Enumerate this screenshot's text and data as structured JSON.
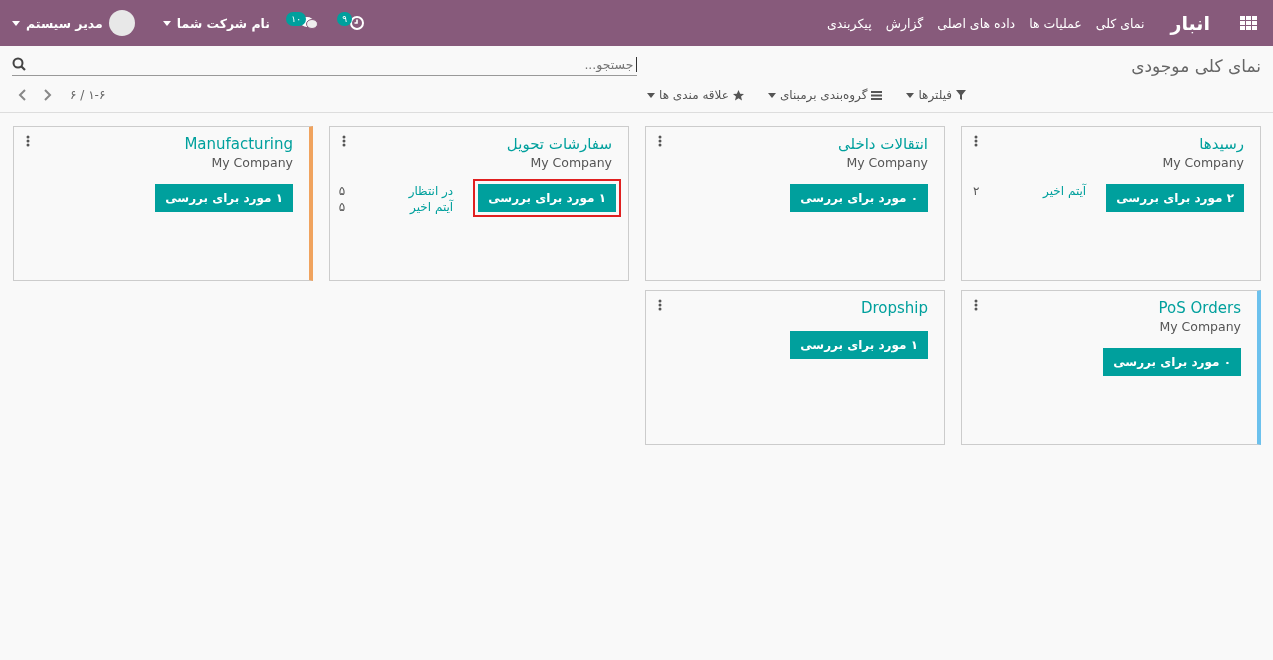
{
  "navbar": {
    "app_title": "انبار",
    "menu": [
      "نمای کلی",
      "عملیات ها",
      "داده های اصلی",
      "گزارش",
      "پیکربندی"
    ],
    "activity_count": "۹",
    "messages_count": "۱۰",
    "company": "نام شرکت شما",
    "user": "مدیر سیستم"
  },
  "breadcrumb": "نمای کلی موجودی",
  "search": {
    "placeholder": "جستجو..."
  },
  "filters": [
    "فیلترها",
    "گروه‌بندی برمبنای",
    "علاقه مندی ها"
  ],
  "pager": "۱-۶ / ۶",
  "cards": [
    {
      "title": "رسیدها",
      "company": "My Company",
      "button": "۲ مورد برای بررسی",
      "highlighted": false,
      "stats": [
        {
          "label": "آیتم اخیر",
          "value": "۲"
        }
      ]
    },
    {
      "title": "انتقالات داخلی",
      "company": "My Company",
      "button": "۰ مورد برای بررسی",
      "highlighted": false
    },
    {
      "title": "سفارشات تحویل",
      "company": "My Company",
      "button": "۱ مورد برای بررسی",
      "highlighted": true,
      "stats": [
        {
          "label": "در انتظار",
          "value": "۵"
        },
        {
          "label": "آیتم اخیر",
          "value": "۵"
        }
      ]
    },
    {
      "title": "Manufacturing",
      "company": "My Company",
      "button": "۱ مورد برای بررسی",
      "highlighted": false,
      "color": "#f0a35e"
    },
    {
      "title": "PoS Orders",
      "company": "My Company",
      "button": "۰ مورد برای بررسی",
      "highlighted": false,
      "color": "#6cc1ed"
    },
    {
      "title": "Dropship",
      "button": "۱ مورد برای بررسی",
      "highlighted": false
    }
  ]
}
